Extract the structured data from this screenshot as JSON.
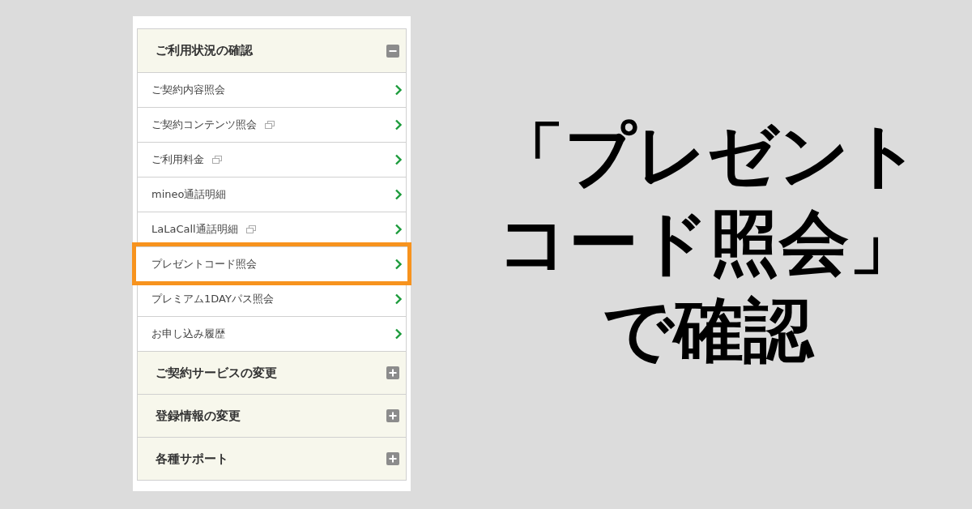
{
  "menu": {
    "sections": [
      {
        "title": "ご利用状況の確認",
        "expanded": true,
        "items": [
          {
            "label": "ご契約内容照会",
            "new_window": false,
            "highlighted": false
          },
          {
            "label": "ご契約コンテンツ照会",
            "new_window": true,
            "highlighted": false
          },
          {
            "label": "ご利用料金",
            "new_window": true,
            "highlighted": false
          },
          {
            "label": "mineo通話明細",
            "new_window": false,
            "highlighted": false
          },
          {
            "label": "LaLaCall通話明細",
            "new_window": true,
            "highlighted": false
          },
          {
            "label": "プレゼントコード照会",
            "new_window": false,
            "highlighted": true
          },
          {
            "label": "プレミアム1DAYパス照会",
            "new_window": false,
            "highlighted": false
          },
          {
            "label": "お申し込み履歴",
            "new_window": false,
            "highlighted": false
          }
        ]
      },
      {
        "title": "ご契約サービスの変更",
        "expanded": false
      },
      {
        "title": "登録情報の変更",
        "expanded": false
      },
      {
        "title": "各種サポート",
        "expanded": false
      }
    ]
  },
  "caption": {
    "lines": [
      "「プレゼント",
      "コード照会」",
      "で確認"
    ]
  }
}
